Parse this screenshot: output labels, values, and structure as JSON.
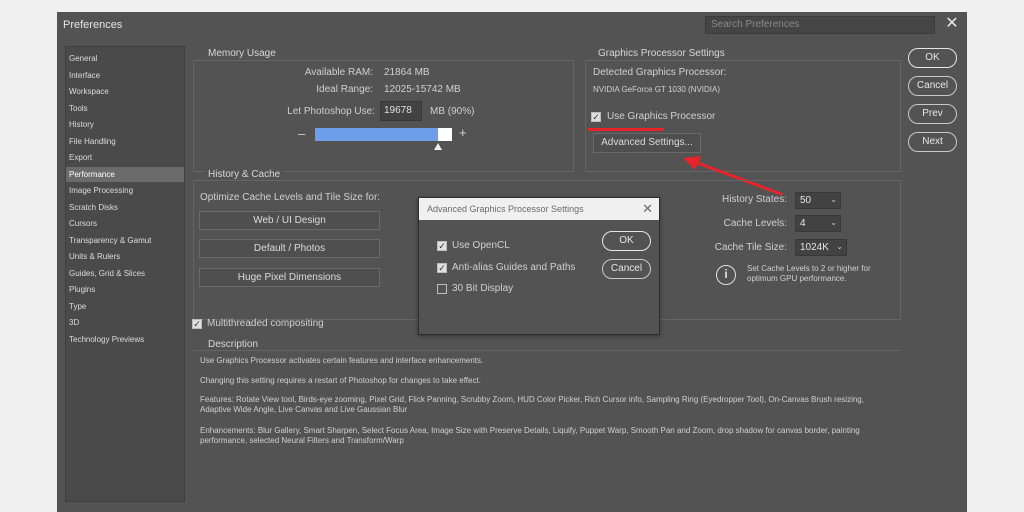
{
  "window": {
    "title": "Preferences",
    "search_placeholder": "Search Preferences",
    "close_glyph": "✕"
  },
  "sidebar": {
    "items": [
      {
        "label": "General",
        "active": false
      },
      {
        "label": "Interface",
        "active": false
      },
      {
        "label": "Workspace",
        "active": false
      },
      {
        "label": "Tools",
        "active": false
      },
      {
        "label": "History",
        "active": false
      },
      {
        "label": "File Handling",
        "active": false
      },
      {
        "label": "Export",
        "active": false
      },
      {
        "label": "Performance",
        "active": true
      },
      {
        "label": "Image Processing",
        "active": false
      },
      {
        "label": "Scratch Disks",
        "active": false
      },
      {
        "label": "Cursors",
        "active": false
      },
      {
        "label": "Transparency & Gamut",
        "active": false
      },
      {
        "label": "Units & Rulers",
        "active": false
      },
      {
        "label": "Guides, Grid & Slices",
        "active": false
      },
      {
        "label": "Plugins",
        "active": false
      },
      {
        "label": "Type",
        "active": false
      },
      {
        "label": "3D",
        "active": false
      },
      {
        "label": "Technology Previews",
        "active": false
      }
    ]
  },
  "memory": {
    "title": "Memory Usage",
    "available_label": "Available RAM:",
    "available_value": "21864 MB",
    "ideal_label": "Ideal Range:",
    "ideal_value": "12025-15742 MB",
    "let_label": "Let Photoshop Use:",
    "let_value": "19678",
    "let_unit": "MB (90%)",
    "minus": "–",
    "plus": "+",
    "slider_fraction": 0.9
  },
  "gpu": {
    "title": "Graphics Processor Settings",
    "detected_label": "Detected Graphics Processor:",
    "detected_value": "NVIDIA GeForce GT 1030 (NVIDIA)",
    "use_gpu_label": "Use Graphics Processor",
    "use_gpu_checked": true,
    "advanced_button": "Advanced Settings..."
  },
  "history_cache": {
    "title": "History & Cache",
    "optimize_label": "Optimize Cache Levels and Tile Size for:",
    "buttons": [
      "Web / UI Design",
      "Default / Photos",
      "Huge Pixel Dimensions"
    ],
    "history_states_label": "History States:",
    "history_states_value": "50",
    "cache_levels_label": "Cache Levels:",
    "cache_levels_value": "4",
    "tile_size_label": "Cache Tile Size:",
    "tile_size_value": "1024K",
    "info_text_1": "Set Cache Levels to 2 or higher for",
    "info_text_2": "optimum GPU performance."
  },
  "multithreaded": {
    "label": "Multithreaded compositing",
    "checked": true
  },
  "description": {
    "title": "Description",
    "line1": "Use Graphics Processor activates certain features and interface enhancements.",
    "line2": "Changing this setting requires a restart of Photoshop for changes to take effect.",
    "features_1": "Features: Rotate View tool, Birds-eye zooming, Pixel Grid, Flick Panning, Scrubby Zoom, HUD Color Picker, Rich Cursor info, Sampling Ring (Eyedropper Tool), On-Canvas Brush resizing,",
    "features_2": "Adaptive Wide Angle, Live Canvas and Live Gaussian Blur",
    "enh_1": "Enhancements: Blur Gallery, Smart Sharpen, Select Focus Area, Image Size with Preserve Details, Liquify, Puppet Warp, Smooth Pan and Zoom, drop shadow for canvas border, painting",
    "enh_2": "performance, selected Neural Filters and Transform/Warp"
  },
  "side_buttons": {
    "ok": "OK",
    "cancel": "Cancel",
    "prev": "Prev",
    "next": "Next"
  },
  "dialog": {
    "title": "Advanced Graphics Processor Settings",
    "close": "✕",
    "options": [
      {
        "label": "Use OpenCL",
        "checked": true
      },
      {
        "label": "Anti-alias Guides and Paths",
        "checked": true
      },
      {
        "label": "30 Bit Display",
        "checked": false
      }
    ],
    "ok": "OK",
    "cancel": "Cancel"
  },
  "colors": {
    "annotation": "#e8242b",
    "slider_fill": "#6d9eea",
    "panel": "#535353"
  },
  "chevron": "⌄",
  "check_glyph": "✓",
  "info_glyph": "i"
}
